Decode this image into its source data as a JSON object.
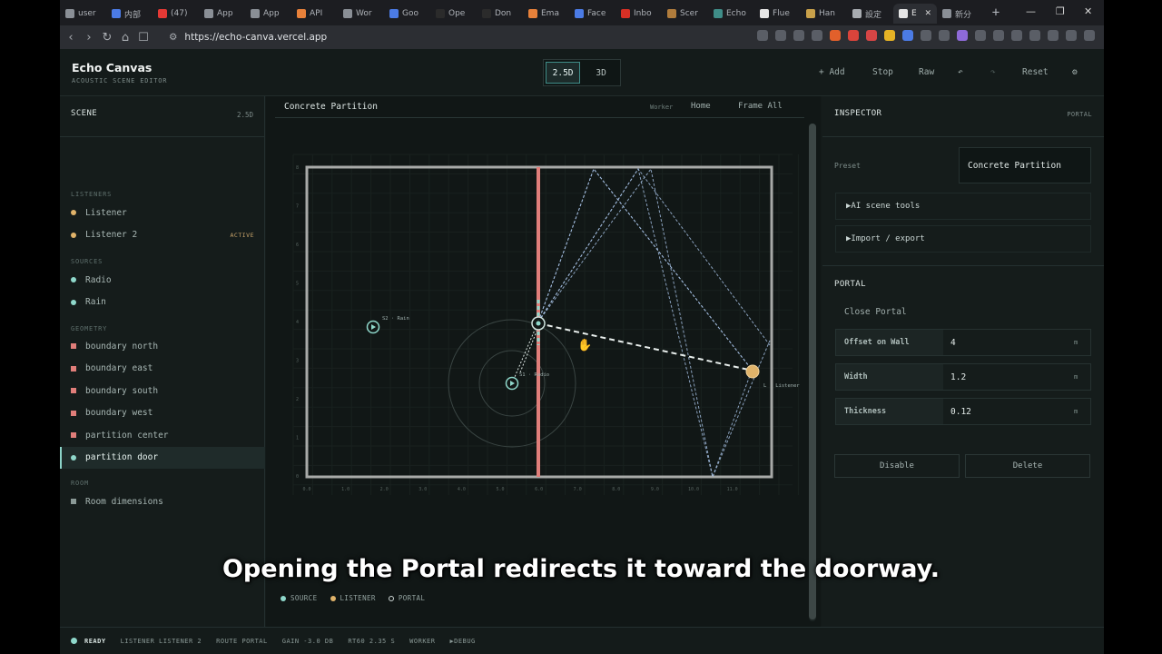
{
  "browser": {
    "tabs": [
      {
        "label": "user",
        "color": "#8a8f96"
      },
      {
        "label": "内部",
        "color": "#4b7be5"
      },
      {
        "label": "(47)",
        "color": "#e53935"
      },
      {
        "label": "App",
        "color": "#8a8f96"
      },
      {
        "label": "App",
        "color": "#8a8f96"
      },
      {
        "label": "API",
        "color": "#e8813a"
      },
      {
        "label": "Wor",
        "color": "#8a8f96"
      },
      {
        "label": "Goo",
        "color": "#4b7be5"
      },
      {
        "label": "Ope",
        "color": "#2b2b2b"
      },
      {
        "label": "Don",
        "color": "#2b2b2b"
      },
      {
        "label": "Ema",
        "color": "#e8813a"
      },
      {
        "label": "Face",
        "color": "#4b7be5"
      },
      {
        "label": "Inbo",
        "color": "#d93025"
      },
      {
        "label": "Scer",
        "color": "#b07c3c"
      },
      {
        "label": "Echo",
        "color": "#3f8d88"
      },
      {
        "label": "Flue",
        "color": "#e6e6e6"
      },
      {
        "label": "Han",
        "color": "#c9a14a"
      },
      {
        "label": "設定",
        "color": "#a8acb1"
      },
      {
        "label": "E",
        "color": "#e6e6e6",
        "active": true
      },
      {
        "label": "新分",
        "color": "#8a8f96"
      }
    ],
    "new_tab": "+",
    "win_min": "—",
    "win_max": "❐",
    "win_close": "✕",
    "url": "https://echo-canva.vercel.app",
    "nav_back": "‹",
    "nav_forward": "›",
    "nav_reload": "↻",
    "nav_home": "⌂",
    "nav_bookmark": "☐"
  },
  "app": {
    "title": "Echo Canvas",
    "subtitle": "ACOUSTIC SCENE EDITOR",
    "view_modes": [
      "2.5D",
      "3D"
    ],
    "active_view": "2.5D",
    "header_actions": {
      "add": "+ Add",
      "stop": "Stop",
      "raw": "Raw",
      "undo": "↶",
      "redo": "↷",
      "reset": "Reset",
      "settings": "⚙"
    }
  },
  "scene_panel": {
    "title": "SCENE",
    "mode": "2.5D",
    "groups": {
      "listeners": "LISTENERS",
      "sources": "SOURCES",
      "geometry": "GEOMETRY",
      "room": "ROOM"
    },
    "listeners": [
      {
        "label": "Listener",
        "color": "#e0b36a"
      },
      {
        "label": "Listener 2",
        "color": "#e0b36a",
        "badge": "ACTIVE"
      }
    ],
    "sources": [
      {
        "label": "Radio",
        "color": "#8fd8cb"
      },
      {
        "label": "Rain",
        "color": "#8fd8cb"
      }
    ],
    "geometry": [
      {
        "label": "boundary north",
        "color": "#e07e7a"
      },
      {
        "label": "boundary east",
        "color": "#e07e7a"
      },
      {
        "label": "boundary south",
        "color": "#e07e7a"
      },
      {
        "label": "boundary west",
        "color": "#e07e7a"
      },
      {
        "label": "partition center",
        "color": "#e07e7a"
      },
      {
        "label": "partition door",
        "color": "#8fd8cb",
        "selected": true
      }
    ],
    "room": [
      {
        "label": "Room dimensions",
        "color": "#8a9996"
      }
    ]
  },
  "canvas": {
    "title": "Concrete Partition",
    "worker": "Worker",
    "home": "Home",
    "frame_all": "Frame All",
    "x_ticks": [
      "0.0",
      "1.0",
      "2.0",
      "3.0",
      "4.0",
      "5.0",
      "6.0",
      "7.0",
      "8.0",
      "9.0",
      "10.0",
      "11.0"
    ],
    "y_ticks": [
      "8",
      "7",
      "6",
      "5",
      "4",
      "3",
      "2",
      "1",
      "0"
    ],
    "source_labels": {
      "rain": "S2 · Rain",
      "radio": "S1 · Radio"
    },
    "listener_label": "L · Listener",
    "legend": {
      "source": "SOURCE",
      "listener": "LISTENER",
      "portal": "PORTAL"
    },
    "colors": {
      "source": "#8fd8cb",
      "listener": "#e0b36a",
      "wall": "#e07e7a",
      "ray": "#a9c4e8",
      "room": "#a8aaa8"
    }
  },
  "inspector": {
    "title": "INSPECTOR",
    "tag": "PORTAL",
    "preset_label": "Preset",
    "preset_value": "Concrete Partition",
    "ai_tools": "▶AI scene tools",
    "import_export": "▶Import / export",
    "portal_title": "PORTAL",
    "close_portal": "Close Portal",
    "fields": [
      {
        "label": "Offset on Wall",
        "value": "4",
        "unit": "m"
      },
      {
        "label": "Width",
        "value": "1.2",
        "unit": "m"
      },
      {
        "label": "Thickness",
        "value": "0.12",
        "unit": "m"
      }
    ],
    "disable": "Disable",
    "delete": "Delete"
  },
  "status": {
    "ready": "READY",
    "listener": "LISTENER LISTENER 2",
    "route": "ROUTE PORTAL",
    "gain": "GAIN -3.0 DB",
    "rt60": "RT60 2.35 S",
    "worker": "WORKER",
    "debug": "▶DEBUG",
    "ready_color": "#8fd8cb"
  },
  "caption": "Opening the Portal redirects it toward the doorway."
}
